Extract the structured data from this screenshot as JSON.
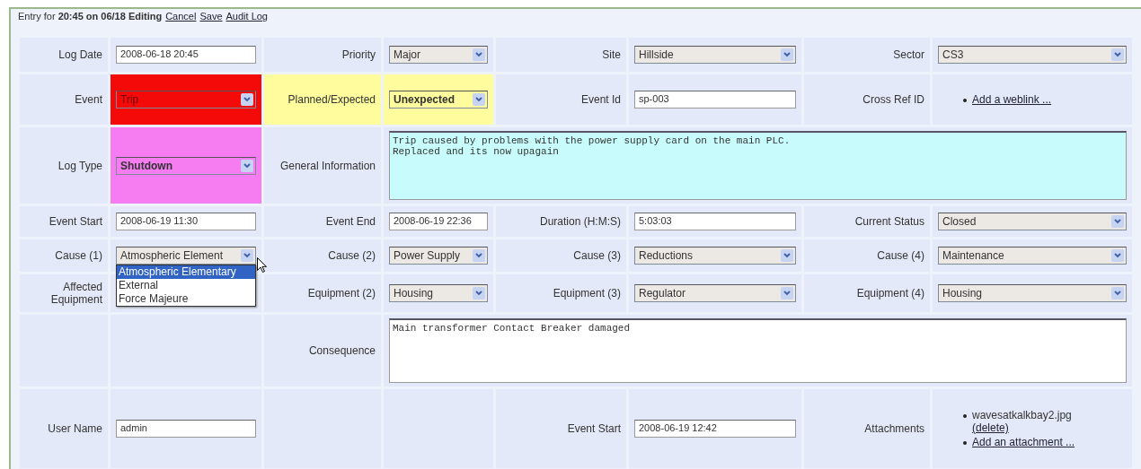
{
  "header": {
    "title": "Entry for **20:45 on 06/18 Editing**",
    "links": [
      "Cancel",
      "Save",
      "Audit Log"
    ]
  },
  "rows": [
    {
      "fields": [
        {
          "kind": "input",
          "label": "Log Date",
          "value": "2008-06-18 20:45"
        },
        {
          "kind": "select",
          "label": "Priority",
          "value": "Major"
        },
        {
          "kind": "select",
          "label": "Site",
          "value": "Hillside"
        },
        {
          "kind": "select",
          "label": "Sector",
          "value": "CS3"
        }
      ]
    },
    {
      "fields": [
        {
          "kind": "select",
          "label": "Event",
          "value": "Trip",
          "color": "#f50a0a"
        },
        {
          "kind": "select",
          "label": "Planned/Expected",
          "value": "Unexpected",
          "color": "#fefc9c",
          "label_highlighted": true,
          "bold": true
        },
        {
          "kind": "input",
          "label": "Event Id",
          "value": "sp-003"
        },
        {
          "kind": "links",
          "label": "Cross Ref ID",
          "items": [
            {
              "link": "Add a weblink ..."
            }
          ]
        }
      ]
    },
    {
      "fields": [
        {
          "kind": "select",
          "label": "Log Type",
          "value": "Shutdown",
          "color": "#f67cf2",
          "bold": true
        },
        {
          "kind": "textarea",
          "label": "General Information",
          "value": "Trip caused by problems with the power supply card on the main PLC.\nReplaced and its now upagain",
          "color": "#c8fcfc"
        }
      ]
    },
    {
      "fields": [
        {
          "kind": "input",
          "label": "Event Start",
          "value": "2008-06-19 11:30"
        },
        {
          "kind": "input",
          "label": "Event End",
          "value": "2008-06-19 22:36"
        },
        {
          "kind": "input",
          "label": "Duration (H:M:S)",
          "value": "5:03:03"
        },
        {
          "kind": "select",
          "label": "Current Status",
          "value": "Closed"
        }
      ]
    },
    {
      "fields": [
        {
          "kind": "select",
          "label": "Cause (1)",
          "value": "Atmospheric Element",
          "expanded": true,
          "options": [
            {
              "label": "Atmospheric Elementary",
              "selected": true
            },
            {
              "label": "External",
              "selected": false
            },
            {
              "label": "Force Majeure",
              "selected": false
            }
          ]
        },
        {
          "kind": "select",
          "label": "Cause (2)",
          "value": "Power Supply"
        },
        {
          "kind": "select",
          "label": "Cause (3)",
          "value": "Reductions"
        },
        {
          "kind": "select",
          "label": "Cause (4)",
          "value": "Maintenance"
        }
      ]
    },
    {
      "fields": [
        {
          "kind": "blank",
          "label": "Affected Equipment"
        },
        {
          "kind": "select",
          "label": "Equipment (2)",
          "value": "Housing"
        },
        {
          "kind": "select",
          "label": "Equipment (3)",
          "value": "Regulator"
        },
        {
          "kind": "select",
          "label": "Equipment (4)",
          "value": "Housing"
        }
      ]
    },
    {
      "fields": [
        {
          "kind": "blank"
        },
        {
          "kind": "textarea",
          "label": "Consequence",
          "value": "Main transformer Contact Breaker damaged",
          "color": "#ffffff"
        }
      ]
    },
    {
      "fields": [
        {
          "kind": "input",
          "label": "User Name",
          "value": "admin"
        },
        {
          "kind": "blank"
        },
        {
          "kind": "input",
          "label": "Event Start",
          "value": "2008-06-19 12:42"
        },
        {
          "kind": "links",
          "label": "Attachments",
          "items": [
            {
              "text": "wavesatkalkbay2.jpg",
              "link": "(delete)"
            },
            {
              "link": "Add an attachment ..."
            }
          ]
        }
      ]
    }
  ]
}
